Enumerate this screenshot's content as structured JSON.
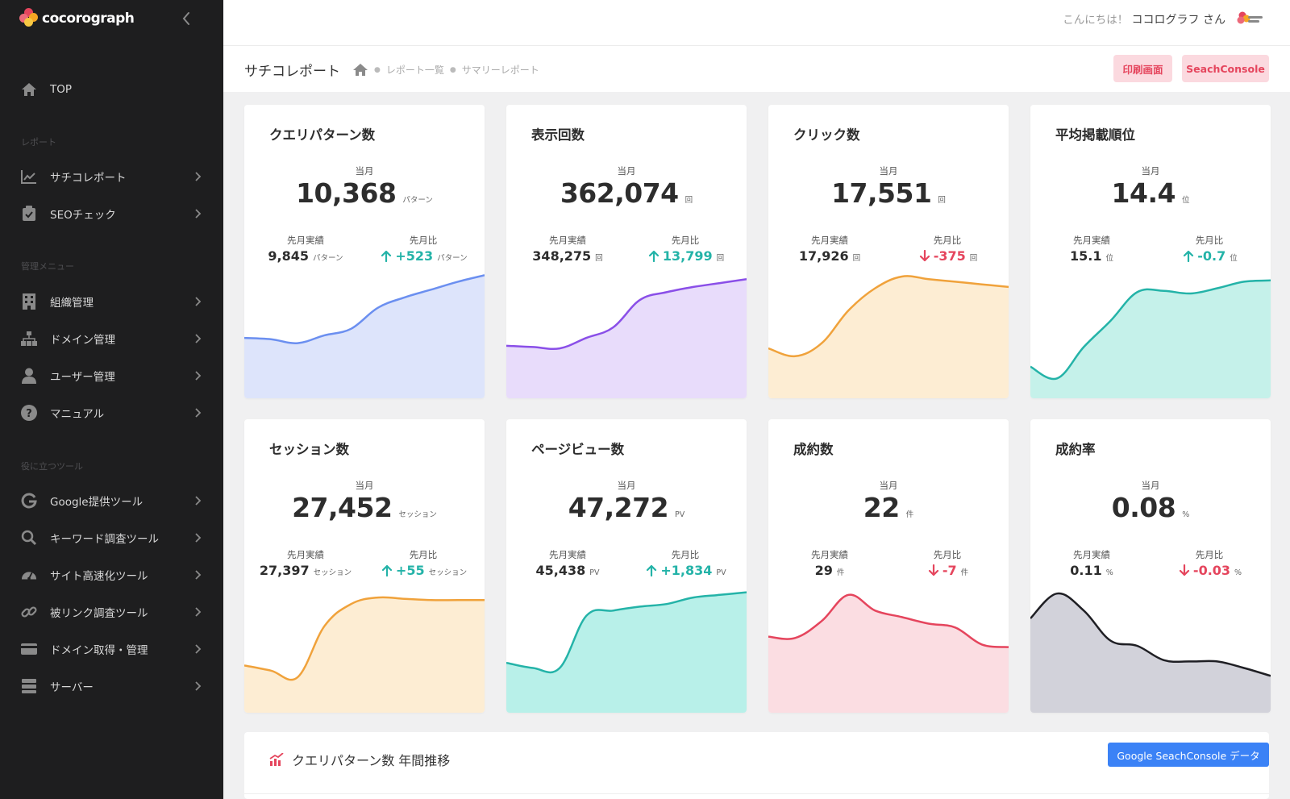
{
  "brand": {
    "name": "cocorograph",
    "petal_colors": [
      "#e5455d",
      "#f5a623",
      "#ec6a7a",
      "#f7c843"
    ]
  },
  "sidebar": {
    "top": {
      "label": "TOP",
      "icon": "home-icon"
    },
    "sections": [
      {
        "title": "レポート",
        "items": [
          {
            "label": "サチコレポート",
            "icon": "line-chart-icon"
          },
          {
            "label": "SEOチェック",
            "icon": "clipboard-check-icon"
          }
        ]
      },
      {
        "title": "管理メニュー",
        "items": [
          {
            "label": "組織管理",
            "icon": "building-icon"
          },
          {
            "label": "ドメイン管理",
            "icon": "sitemap-icon"
          },
          {
            "label": "ユーザー管理",
            "icon": "user-icon"
          },
          {
            "label": "マニュアル",
            "icon": "question-circle-icon"
          }
        ]
      },
      {
        "title": "役に立つツール",
        "items": [
          {
            "label": "Google提供ツール",
            "icon": "google-icon"
          },
          {
            "label": "キーワード調査ツール",
            "icon": "search-icon"
          },
          {
            "label": "サイト高速化ツール",
            "icon": "speedometer-icon"
          },
          {
            "label": "被リンク調査ツール",
            "icon": "link-icon"
          },
          {
            "label": "ドメイン取得・管理",
            "icon": "card-icon"
          },
          {
            "label": "サーバー",
            "icon": "server-icon"
          }
        ]
      }
    ]
  },
  "header": {
    "greeting": "こんにちは！",
    "user_name": "ココログラフ さん"
  },
  "subheader": {
    "page_title": "サチコレポート",
    "breadcrumb": [
      "レポート一覧",
      "サマリーレポート"
    ],
    "print_button": "印刷画面",
    "console_button": "SeachConsole"
  },
  "colors": {
    "up": "#24b3a8",
    "down": "#e5455d",
    "primary": "#3b82f6",
    "pink_button_bg": "#fbd9df",
    "pink_button_text": "#e5455d"
  },
  "labels": {
    "current": "当月",
    "previous": "先月実績",
    "diff": "先月比"
  },
  "cards": [
    {
      "title": "クエリパターン数",
      "current": "10,368",
      "unit": "パターン",
      "previous": "9,845",
      "diff": "+523",
      "direction": "up",
      "line_color": "#6b8ff0",
      "fill_color": "#dde4fb",
      "trend": [
        0.45,
        0.44,
        0.41,
        0.47,
        0.52,
        0.68,
        0.76,
        0.82,
        0.88,
        0.93
      ]
    },
    {
      "title": "表示回数",
      "current": "362,074",
      "unit": "回",
      "previous": "348,275",
      "diff": "13,799",
      "direction": "up",
      "line_color": "#8a4fe8",
      "fill_color": "#e8dcfb",
      "trend": [
        0.39,
        0.38,
        0.37,
        0.45,
        0.53,
        0.74,
        0.8,
        0.84,
        0.87,
        0.9
      ]
    },
    {
      "title": "クリック数",
      "current": "17,551",
      "unit": "回",
      "previous": "17,926",
      "diff": "-375",
      "direction": "down",
      "line_color": "#f0a23b",
      "fill_color": "#fdedd3",
      "trend": [
        0.37,
        0.31,
        0.41,
        0.66,
        0.83,
        0.92,
        0.9,
        0.88,
        0.86,
        0.84
      ]
    },
    {
      "title": "平均掲載順位",
      "current": "14.4",
      "unit": "位",
      "previous": "15.1",
      "diff": "-0.7",
      "direction": "up",
      "line_color": "#24b3a8",
      "fill_color": "#c5f1ea",
      "trend": [
        0.23,
        0.14,
        0.38,
        0.58,
        0.8,
        0.81,
        0.79,
        0.83,
        0.88,
        0.89
      ]
    },
    {
      "title": "セッション数",
      "current": "27,452",
      "unit": "セッション",
      "previous": "27,397",
      "diff": "+55",
      "direction": "up",
      "line_color": "#f0a23b",
      "fill_color": "#fdedd3",
      "trend": [
        0.35,
        0.31,
        0.26,
        0.65,
        0.82,
        0.87,
        0.86,
        0.85,
        0.85,
        0.85
      ]
    },
    {
      "title": "ページビュー数",
      "current": "47,272",
      "unit": "PV",
      "previous": "45,438",
      "diff": "+1,834",
      "direction": "up",
      "line_color": "#24b3a8",
      "fill_color": "#b8f0e9",
      "trend": [
        0.37,
        0.33,
        0.33,
        0.73,
        0.77,
        0.8,
        0.82,
        0.87,
        0.89,
        0.91
      ]
    },
    {
      "title": "成約数",
      "current": "22",
      "unit": "件",
      "previous": "29",
      "diff": "-7",
      "direction": "down",
      "line_color": "#e5455d",
      "fill_color": "#fbdde2",
      "trend": [
        0.57,
        0.56,
        0.69,
        0.89,
        0.77,
        0.72,
        0.67,
        0.64,
        0.51,
        0.49
      ]
    },
    {
      "title": "成約率",
      "current": "0.08",
      "unit": "%",
      "previous": "0.11",
      "diff": "-0.03",
      "direction": "down",
      "line_color": "#1f1f24",
      "fill_color": "#d2d2da",
      "trend": [
        0.71,
        0.9,
        0.77,
        0.54,
        0.5,
        0.39,
        0.38,
        0.38,
        0.33,
        0.27
      ]
    }
  ],
  "bottom": {
    "title": "クエリパターン数 年間推移",
    "button": "Google SeachConsole データ"
  }
}
